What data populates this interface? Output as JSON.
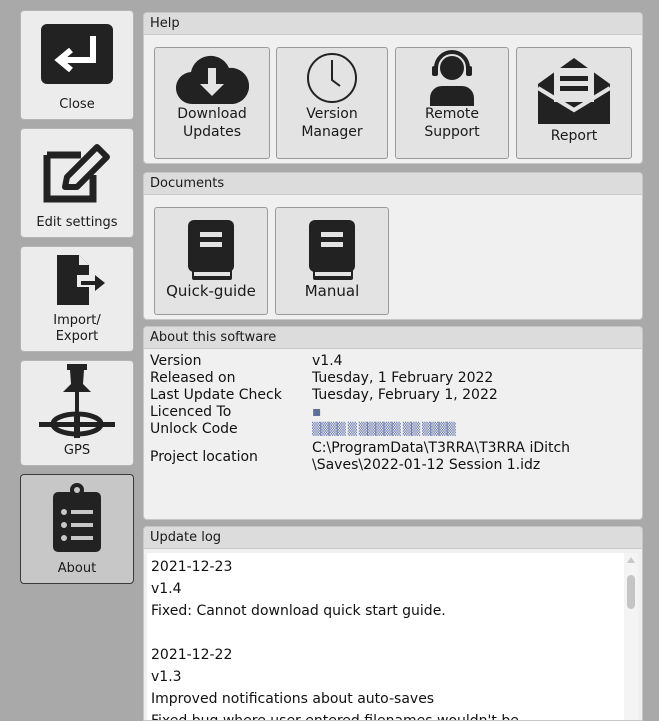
{
  "sidebar": {
    "close_label": "Close",
    "edit_label": "Edit settings",
    "import_label": "Import/\nExport",
    "gps_label": "GPS",
    "about_label": "About"
  },
  "help": {
    "title": "Help",
    "download_label": "Download\nUpdates",
    "version_label": "Version\nManager",
    "remote_label": "Remote\nSupport",
    "report_label": "Report"
  },
  "documents": {
    "title": "Documents",
    "quickguide_label": "Quick-guide",
    "manual_label": "Manual"
  },
  "about": {
    "title": "About this software",
    "rows": [
      {
        "key": "Version",
        "value": "v1.4"
      },
      {
        "key": "Released on",
        "value": "Tuesday, 1 February 2022"
      },
      {
        "key": "Last Update Check",
        "value": "Tuesday, February 1, 2022"
      },
      {
        "key": "Licenced To",
        "value": "▪"
      },
      {
        "key": "Unlock Code",
        "value": "▒▒▒▒ ▒ ▒▒▒▒▒ ▒▒ ▒▒▒▒"
      },
      {
        "key": "Project location",
        "value": "C:\\ProgramData\\T3RRA\\T3RRA iDitch\n\\Saves\\2022-01-12 Session 1.idz"
      }
    ]
  },
  "update_log": {
    "title": "Update log",
    "text": "2021-12-23\nv1.4\nFixed: Cannot download quick start guide.\n\n2021-12-22\nv1.3\nImproved notifications about auto-saves\nFixed bug where user entered filenames wouldn't be"
  }
}
